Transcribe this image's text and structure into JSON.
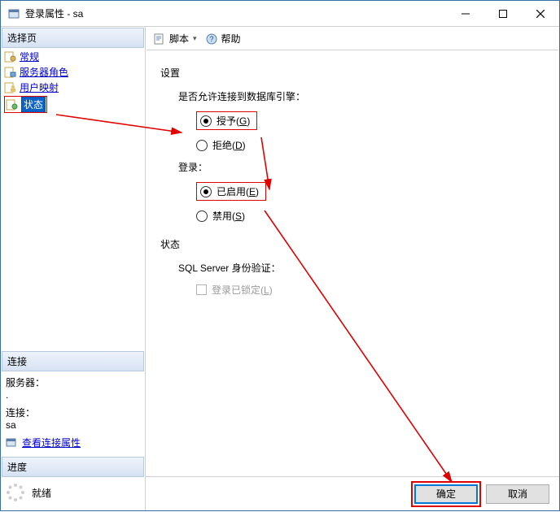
{
  "window": {
    "title": "登录属性 - sa"
  },
  "left": {
    "select_page_hdr": "选择页",
    "nav": [
      {
        "label": "常规",
        "icon": "page-gear"
      },
      {
        "label": "服务器角色",
        "icon": "page-role"
      },
      {
        "label": "用户映射",
        "icon": "page-user"
      },
      {
        "label": "状态",
        "icon": "page-status"
      }
    ],
    "connection_hdr": "连接",
    "server_label": "服务器：",
    "server_value": ".",
    "conn_label": "连接：",
    "conn_value": "sa",
    "conn_link": "查看连接属性",
    "progress_hdr": "进度",
    "progress_text": "就绪"
  },
  "toolbar": {
    "script_label": "脚本",
    "help_label": "帮助"
  },
  "content": {
    "settings_hdr": "设置",
    "perm_label": "是否允许连接到数据库引擎：",
    "perm_grant": "授予(G)",
    "perm_grant_u": "G",
    "perm_deny": "拒绝(D)",
    "perm_deny_u": "D",
    "login_label": "登录：",
    "login_enabled": "已启用(E)",
    "login_enabled_u": "E",
    "login_disabled": "禁用(S)",
    "login_disabled_u": "S",
    "status_hdr": "状态",
    "auth_label": "SQL Server 身份验证：",
    "locked_label": "登录已锁定(L)",
    "locked_u": "L"
  },
  "footer": {
    "ok": "确定",
    "cancel": "取消"
  }
}
